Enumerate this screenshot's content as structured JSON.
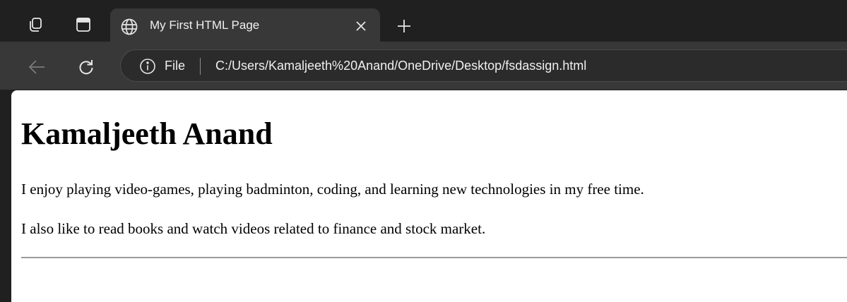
{
  "tab": {
    "title": "My First HTML Page",
    "favicon": "globe-icon"
  },
  "tabstrip": {
    "workspaces_icon": "workspaces-icon",
    "tab_actions_icon": "tab-actions-icon",
    "close_icon": "close-icon",
    "new_tab_icon": "plus-icon"
  },
  "toolbar": {
    "back_icon": "arrow-left-icon",
    "refresh_icon": "refresh-icon",
    "info_icon": "info-icon",
    "file_label": "File",
    "url": "C:/Users/Kamaljeeth%20Anand/OneDrive/Desktop/fsdassign.html"
  },
  "page": {
    "heading": "Kamaljeeth Anand",
    "paragraphs": [
      "I enjoy playing video-games, playing badminton, coding, and learning new technologies in my free time.",
      "I also like to read books and watch videos related to finance and stock market."
    ]
  },
  "colors": {
    "tabstrip_bg": "#202020",
    "active_tab_bg": "#383838",
    "toolbar_bg": "#383838",
    "addressbar_bg": "#2b2b2b",
    "page_bg": "#ffffff"
  }
}
